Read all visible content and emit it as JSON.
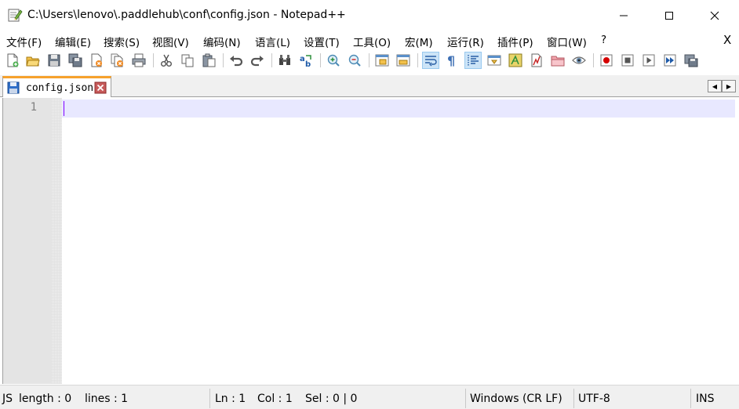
{
  "window": {
    "title": "C:\\Users\\lenovo\\.paddlehub\\conf\\config.json - Notepad++"
  },
  "menu": {
    "items": [
      "文件(F)",
      "编辑(E)",
      "搜索(S)",
      "视图(V)",
      "编码(N)",
      "语言(L)",
      "设置(T)",
      "工具(O)",
      "宏(M)",
      "运行(R)",
      "插件(P)",
      "窗口(W)",
      "?"
    ],
    "close_label": "X"
  },
  "toolbar": {
    "icons": [
      "new-file-icon",
      "open-file-icon",
      "save-icon",
      "save-all-icon",
      "close-icon",
      "close-all-icon",
      "print-icon",
      "cut-icon",
      "copy-icon",
      "paste-icon",
      "undo-icon",
      "redo-icon",
      "find-icon",
      "replace-icon",
      "zoom-in-icon",
      "zoom-out-icon",
      "sync-vertical-icon",
      "sync-horizontal-icon",
      "word-wrap-icon",
      "show-all-characters-icon",
      "indent-guide-icon",
      "document-map-icon",
      "function-list-icon",
      "folder-as-workspace-icon",
      "monitoring-icon",
      "record-macro-icon",
      "stop-recording-icon",
      "play-macro-icon",
      "run-macro-multiple-icon",
      "save-macro-icon"
    ]
  },
  "tabs": [
    {
      "label": "config.json"
    }
  ],
  "editor": {
    "line_numbers": [
      "1"
    ],
    "colors": {
      "current_line": "#e8e8ff",
      "caret": "#8000ff",
      "tab_accent": "#f6a12c"
    }
  },
  "status": {
    "language": "JS",
    "length": "length : 0",
    "lines": "lines : 1",
    "ln": "Ln : 1",
    "col": "Col : 1",
    "sel": "Sel : 0 | 0",
    "eol": "Windows (CR LF)",
    "encoding": "UTF-8",
    "mode": "INS"
  }
}
